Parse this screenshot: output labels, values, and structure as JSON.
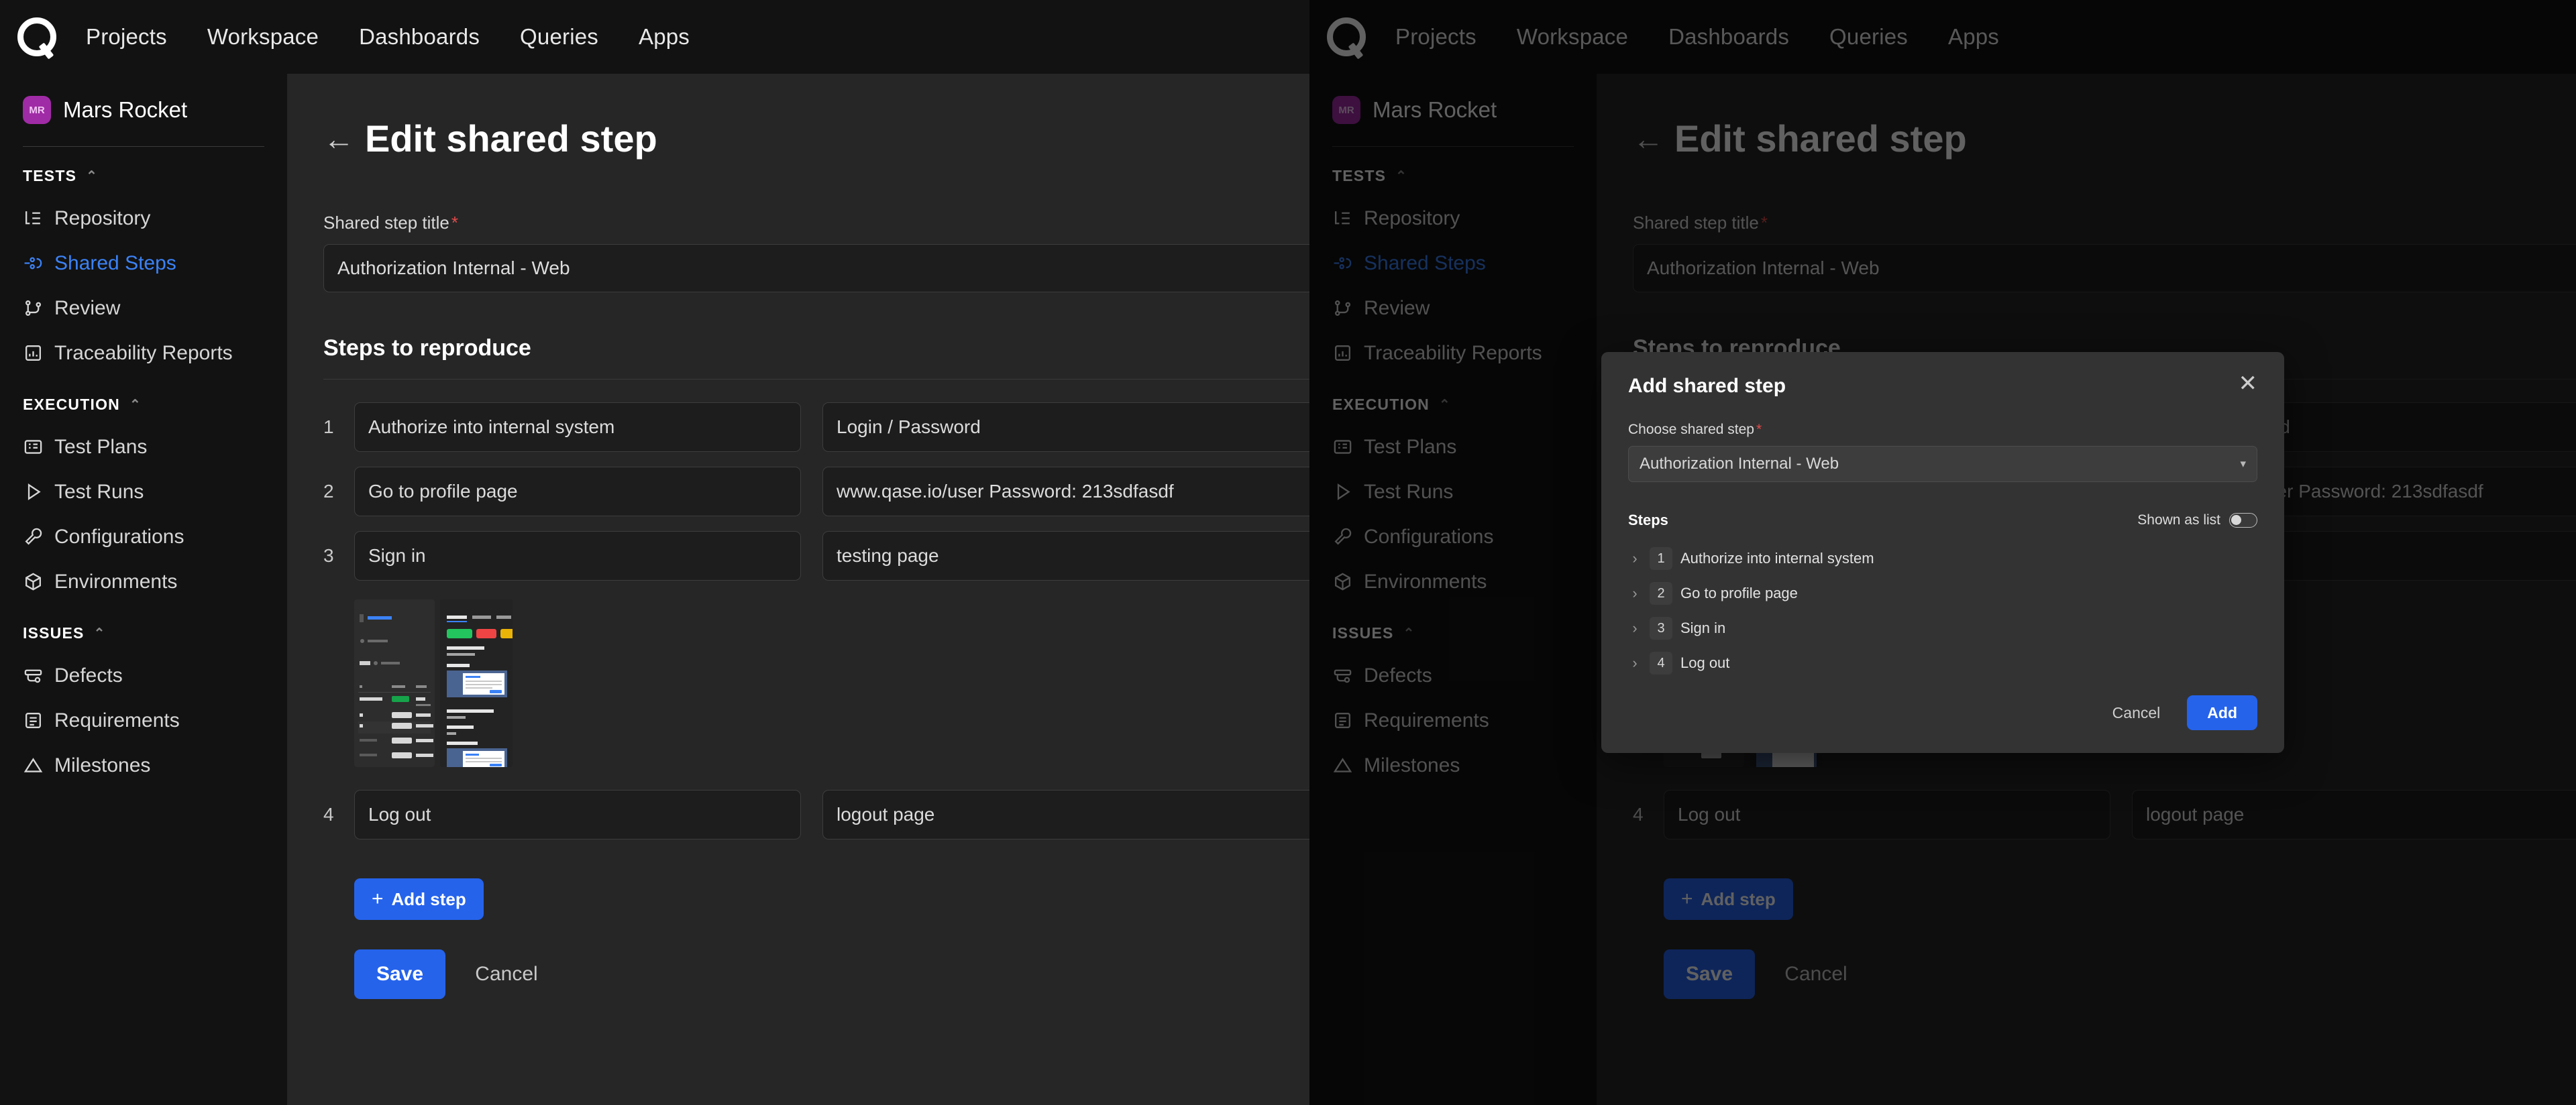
{
  "topnav": {
    "logo": "qase-logo",
    "items": [
      {
        "label": "Projects"
      },
      {
        "label": "Workspace"
      },
      {
        "label": "Dashboards"
      },
      {
        "label": "Queries"
      },
      {
        "label": "Apps"
      }
    ]
  },
  "sidebar": {
    "project": {
      "initials": "MR",
      "name": "Mars Rocket"
    },
    "groups": [
      {
        "title": "TESTS",
        "items": [
          {
            "label": "Repository",
            "icon": "tree-list-icon",
            "active": false
          },
          {
            "label": "Shared Steps",
            "icon": "shared-steps-icon",
            "active": true
          },
          {
            "label": "Review",
            "icon": "review-branch-icon",
            "active": false
          },
          {
            "label": "Traceability Reports",
            "icon": "report-chart-icon",
            "active": false
          }
        ]
      },
      {
        "title": "EXECUTION",
        "items": [
          {
            "label": "Test Plans",
            "icon": "list-panel-icon",
            "active": false
          },
          {
            "label": "Test Runs",
            "icon": "play-icon",
            "active": false
          },
          {
            "label": "Configurations",
            "icon": "wrench-icon",
            "active": false
          },
          {
            "label": "Environments",
            "icon": "cube-icon",
            "active": false
          }
        ]
      },
      {
        "title": "ISSUES",
        "items": [
          {
            "label": "Defects",
            "icon": "defect-icon",
            "active": false
          },
          {
            "label": "Requirements",
            "icon": "document-lines-icon",
            "active": false
          },
          {
            "label": "Milestones",
            "icon": "milestone-flag-icon",
            "active": false
          }
        ]
      }
    ]
  },
  "page": {
    "back_arrow": "←",
    "title": "Edit shared step",
    "title_field": {
      "label": "Shared step title",
      "required_mark": "*",
      "value": "Authorization Internal - Web"
    },
    "steps_section": {
      "heading": "Steps to reproduce",
      "rows": [
        {
          "num": "1",
          "action": "Authorize into internal system",
          "data": "Login / Password"
        },
        {
          "num": "2",
          "action": "Go to profile page",
          "data": "www.qase.io/user Password: 213sdfasdf"
        },
        {
          "num": "3",
          "action": "Sign in",
          "data": "testing page"
        },
        {
          "num": "4",
          "action": "Log out",
          "data": "logout page"
        }
      ],
      "attachments": [
        {
          "name": "attachment-thumbnail-1"
        },
        {
          "name": "attachment-thumbnail-2"
        }
      ]
    },
    "add_step_button": {
      "plus": "+",
      "label": "Add step"
    },
    "save_button": "Save",
    "cancel_button": "Cancel"
  },
  "modal": {
    "title": "Add shared step",
    "close_icon": "✕",
    "choose_label": "Choose shared step",
    "required_mark": "*",
    "selected_value": "Authorization Internal - Web",
    "caret": "▾",
    "steps_label": "Steps",
    "toggle_label": "Shown as list",
    "toggle_on": false,
    "steps": [
      {
        "expand": "›",
        "num": "1",
        "label": "Authorize into internal system"
      },
      {
        "expand": "›",
        "num": "2",
        "label": "Go to profile page"
      },
      {
        "expand": "›",
        "num": "3",
        "label": "Sign in"
      },
      {
        "expand": "›",
        "num": "4",
        "label": "Log out"
      }
    ],
    "cancel_button": "Cancel",
    "add_button": "Add"
  },
  "colors": {
    "accent_blue": "#2563eb",
    "active_link": "#3b82f6",
    "required_red": "#e24b4b",
    "project_badge": "#a02ba6"
  }
}
